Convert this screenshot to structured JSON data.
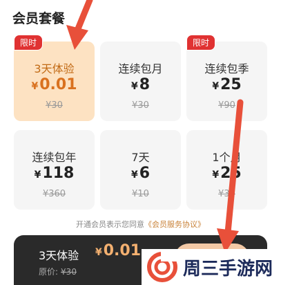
{
  "header": {
    "title": "会员套餐"
  },
  "plans": [
    {
      "badge": "限时",
      "name": "3天体验",
      "currency": "¥",
      "price": "0.01",
      "original": "¥30",
      "selected": true
    },
    {
      "badge": "",
      "name": "连续包月",
      "currency": "¥",
      "price": "8",
      "original": "¥30",
      "selected": false
    },
    {
      "badge": "限时",
      "name": "连续包季",
      "currency": "¥",
      "price": "25",
      "original": "¥90",
      "selected": false
    },
    {
      "badge": "",
      "name": "连续包年",
      "currency": "¥",
      "price": "118",
      "original": "¥360",
      "selected": false
    },
    {
      "badge": "",
      "name": "7天",
      "currency": "¥",
      "price": "6",
      "original": "¥10",
      "selected": false
    },
    {
      "badge": "",
      "name": "1个月",
      "currency": "¥",
      "price": "25",
      "original": "¥30",
      "selected": false
    }
  ],
  "agreement": {
    "text": "开通会员表示您同意",
    "link": "《会员服务协议》"
  },
  "bottom_bar": {
    "plan_name": "3天体验",
    "currency": "¥",
    "price": "0.01",
    "original_label": "原价:",
    "original_price": "¥30"
  },
  "watermark": {
    "text": "周三手游网"
  },
  "colors": {
    "arrow": "#e8503a",
    "selected_card": "#fde2c2",
    "badge": "#e03232",
    "accent": "#d9711f"
  }
}
